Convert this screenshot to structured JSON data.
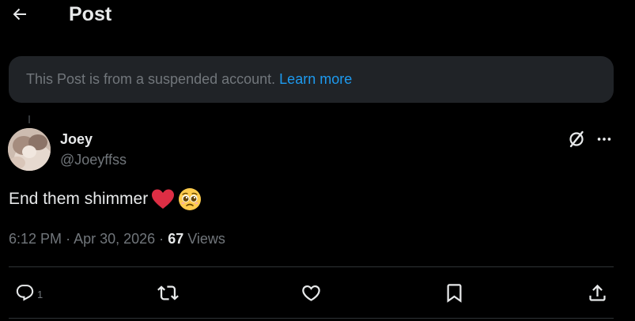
{
  "header": {
    "back_icon": "arrow-left-icon",
    "title": "Post"
  },
  "notice": {
    "text": "This Post is from a suspended account.",
    "link_label": "Learn more",
    "link_color": "#1d9bf0"
  },
  "post": {
    "author": {
      "name": "Joey",
      "handle": "@Joeyffss"
    },
    "text": "End them shimmer",
    "emojis": [
      "red-heart-emoji",
      "pleading-face-emoji"
    ],
    "time": "6:12 PM",
    "separator": "·",
    "date": "Apr 30, 2026",
    "views_count": "67",
    "views_label": "Views"
  },
  "actions": {
    "reply_count": "1",
    "icons": [
      "reply-icon",
      "repost-icon",
      "like-icon",
      "bookmark-icon",
      "share-icon"
    ]
  },
  "colors": {
    "background": "#000000",
    "text_primary": "#e7e9ea",
    "text_secondary": "#71767b",
    "accent": "#1d9bf0",
    "notice_bg": "#202327",
    "divider": "#2f3336"
  }
}
